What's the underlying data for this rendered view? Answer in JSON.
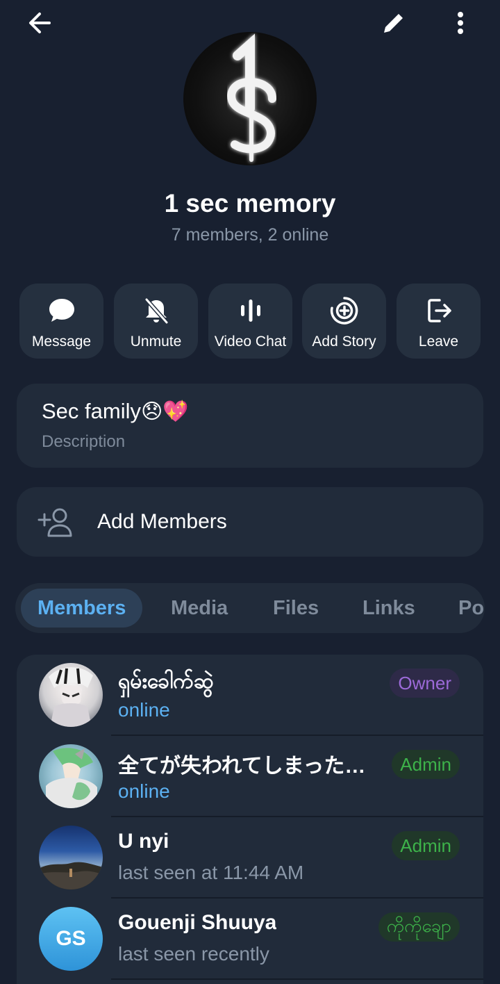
{
  "header": {
    "back_icon": "arrow-left-icon",
    "edit_icon": "pencil-icon",
    "menu_icon": "more-vertical-icon"
  },
  "group": {
    "title": "1 sec memory",
    "subtitle": "7 members, 2 online"
  },
  "actions": [
    {
      "label": "Message",
      "icon": "chat-bubble-icon"
    },
    {
      "label": "Unmute",
      "icon": "bell-off-icon"
    },
    {
      "label": "Video Chat",
      "icon": "voice-bars-icon"
    },
    {
      "label": "Add Story",
      "icon": "add-story-icon"
    },
    {
      "label": "Leave",
      "icon": "leave-icon"
    }
  ],
  "description": {
    "text": "Sec family",
    "emoji": [
      "😞",
      "💖"
    ],
    "label": "Description"
  },
  "add_members": {
    "label": "Add Members",
    "icon": "add-user-icon"
  },
  "tabs": [
    {
      "label": "Members",
      "active": true
    },
    {
      "label": "Media"
    },
    {
      "label": "Files"
    },
    {
      "label": "Links"
    },
    {
      "label": "Po"
    }
  ],
  "members": [
    {
      "name": "ရှမ်းခေါက်ဆွဲ",
      "status": "online",
      "badge": "Owner",
      "badge_type": "owner"
    },
    {
      "name": "全てが失われてしまった…",
      "status": "online",
      "badge": "Admin",
      "badge_type": "admin"
    },
    {
      "name": "U nyi",
      "status": "last seen at 11:44 AM",
      "badge": "Admin",
      "badge_type": "admin"
    },
    {
      "name": "Gouenji Shuuya",
      "status": "last seen recently",
      "badge": "ကိုကိုချော",
      "badge_type": "admin",
      "initials": "GS"
    }
  ],
  "colors": {
    "background": "#182030",
    "card": "#212b3a",
    "accent": "#5cb1f2",
    "owner": "#9c6ad8",
    "admin": "#3db24a"
  }
}
